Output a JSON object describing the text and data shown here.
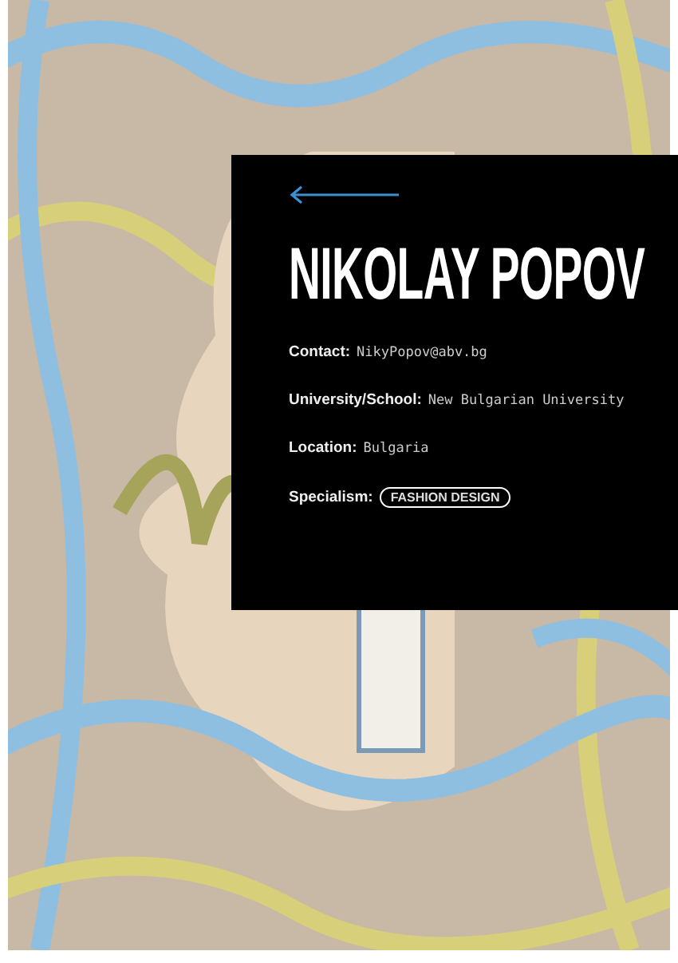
{
  "profile": {
    "name": "NIKOLAY POPOV",
    "fields": [
      {
        "label": "Contact:",
        "value": "NikyPopov@abv.bg",
        "kind": "text"
      },
      {
        "label": "University/School:",
        "value": "New Bulgarian University",
        "kind": "text"
      },
      {
        "label": "Location:",
        "value": "Bulgaria",
        "kind": "text"
      },
      {
        "label": "Specialism:",
        "value": "FASHION DESIGN",
        "kind": "tag"
      }
    ]
  }
}
